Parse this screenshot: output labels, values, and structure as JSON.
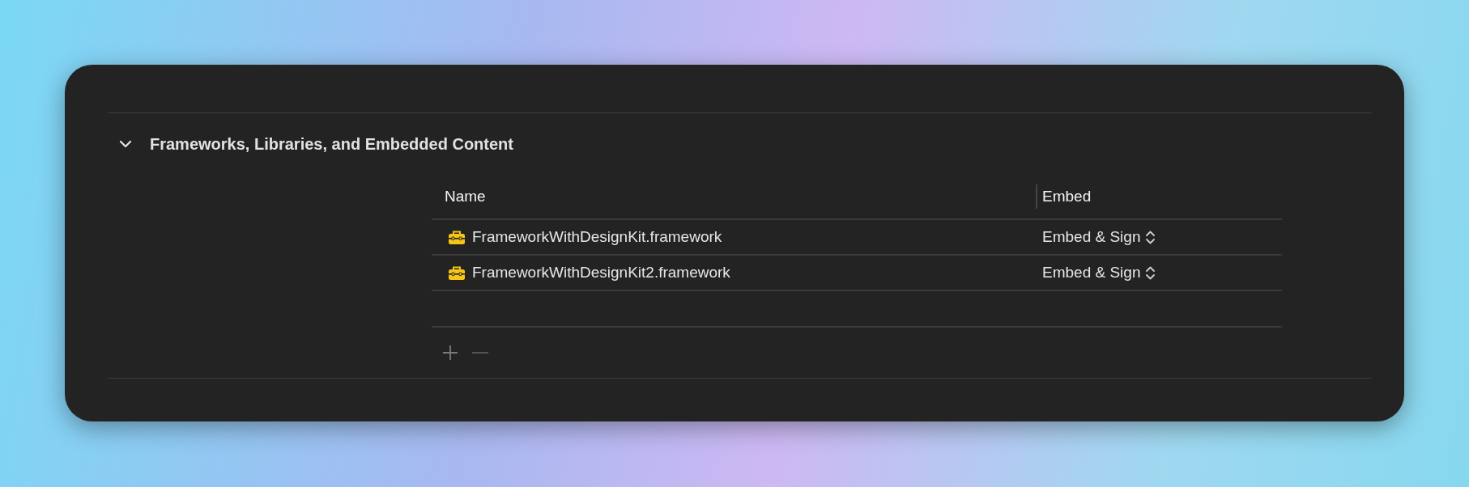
{
  "section": {
    "title": "Frameworks, Libraries, and Embedded Content",
    "expanded": true
  },
  "table": {
    "columns": [
      "Name",
      "Embed"
    ],
    "rows": [
      {
        "name": "FrameworkWithDesignKit.framework",
        "embed": "Embed & Sign"
      },
      {
        "name": "FrameworkWithDesignKit2.framework",
        "embed": "Embed & Sign"
      }
    ]
  },
  "buttons": [
    {
      "kind": "add",
      "disabled": false
    },
    {
      "kind": "remove",
      "disabled": true
    }
  ]
}
